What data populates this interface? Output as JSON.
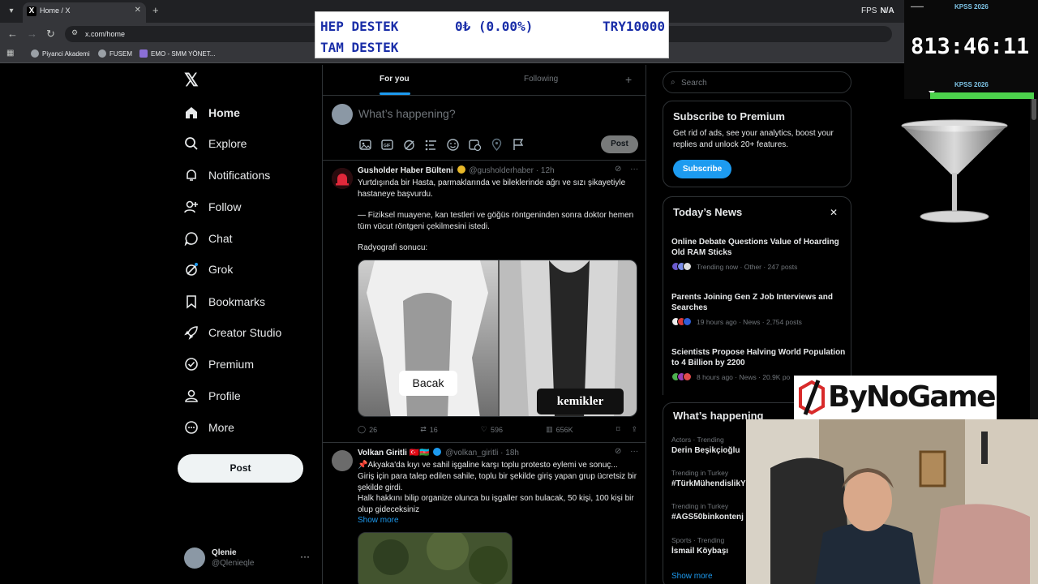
{
  "browser": {
    "tab_title": "Home / X",
    "url": "x.com/home",
    "fps_label": "FPS",
    "fps_value": "N/A",
    "bookmarks": [
      "Piyanci Akademi",
      "FUSEM",
      "EMO - SMM YÖNET..."
    ]
  },
  "banner": {
    "line1_left": "HEP DESTEK",
    "line1_mid": "0₺ (0.00%)",
    "line1_right": "TRY10000",
    "line2": "TAM DESTEK"
  },
  "nav": {
    "items": [
      "Home",
      "Explore",
      "Notifications",
      "Follow",
      "Chat",
      "Grok",
      "Bookmarks",
      "Creator Studio",
      "Premium",
      "Profile",
      "More"
    ],
    "post_button": "Post"
  },
  "account": {
    "name": "Qlenie",
    "handle": "@Qlenieqle"
  },
  "feed": {
    "tabs": [
      "For you",
      "Following"
    ],
    "composer_placeholder": "What’s happening?",
    "composer_post": "Post"
  },
  "tweets": [
    {
      "name": "Gusholder Haber Bülteni",
      "handle": "@gusholderhaber",
      "time": "· 12h",
      "paragraphs": [
        "Yurtdışında bir Hasta, parmaklarında ve bileklerinde ağrı ve sızı şikayetiyle hastaneye başvurdu.",
        "— Fiziksel muayene, kan testleri ve göğüs röntgeninden sonra doktor hemen tüm vücut röntgeni çekilmesini istedi.",
        "Radyografi sonucu:"
      ],
      "image_labels": [
        "Bacak",
        "kemikler"
      ],
      "replies": "26",
      "reposts": "16",
      "likes": "596",
      "views": "656K"
    },
    {
      "name": "Volkan Giritli",
      "flags": "🇹🇷🇦🇿",
      "handle": "@volkan_giritli",
      "time": "· 18h",
      "lines": [
        "📌Akyaka'da kıyı ve sahil işgaline karşı toplu protesto eylemi ve sonuç...",
        "Giriş için para talep edilen sahile, toplu bir şekilde giriş yapan grup ücretsiz bir şekilde girdi.",
        "Halk hakkını bilip organize olunca bu işgaller son bulacak, 50 kişi, 100 kişi bir olup gideceksiniz"
      ],
      "show_more": "Show more"
    }
  ],
  "right": {
    "search_placeholder": "Search",
    "premium": {
      "title": "Subscribe to Premium",
      "body": "Get rid of ads, see your analytics, boost your replies and unlock 20+ features.",
      "button": "Subscribe"
    },
    "news": {
      "title": "Today’s News",
      "items": [
        {
          "title": "Online Debate Questions Value of Hoarding Old RAM Sticks",
          "meta": "Trending now · Other · 247 posts"
        },
        {
          "title": "Parents Joining Gen Z Job Interviews and Searches",
          "meta": "19 hours ago · News · 2,754 posts"
        },
        {
          "title": "Scientists Propose Halving World Population to 4 Billion by 2200",
          "meta": "8 hours ago · News · 20.9K po"
        }
      ]
    },
    "happening": {
      "title": "What’s happening",
      "trends": [
        {
          "context": "Actors · Trending",
          "name": "Derin Beşikçioğlu"
        },
        {
          "context": "Trending in Turkey",
          "name": "#TürkMühendislikY"
        },
        {
          "context": "Trending in Turkey",
          "name": "#AGS50binkontenj"
        },
        {
          "context": "Sports · Trending",
          "name": "İsmail Köybaşı"
        }
      ],
      "show_more": "Show more"
    }
  },
  "overlay": {
    "timer_label": "KPSS 2026",
    "timer_label_bottom": "KPSS 2026",
    "timer": "813:46:11",
    "sponsor": "ByNoGame"
  },
  "colors": {
    "accent": "#1d9bf0",
    "background": "#000000",
    "muted": "#71767b"
  }
}
